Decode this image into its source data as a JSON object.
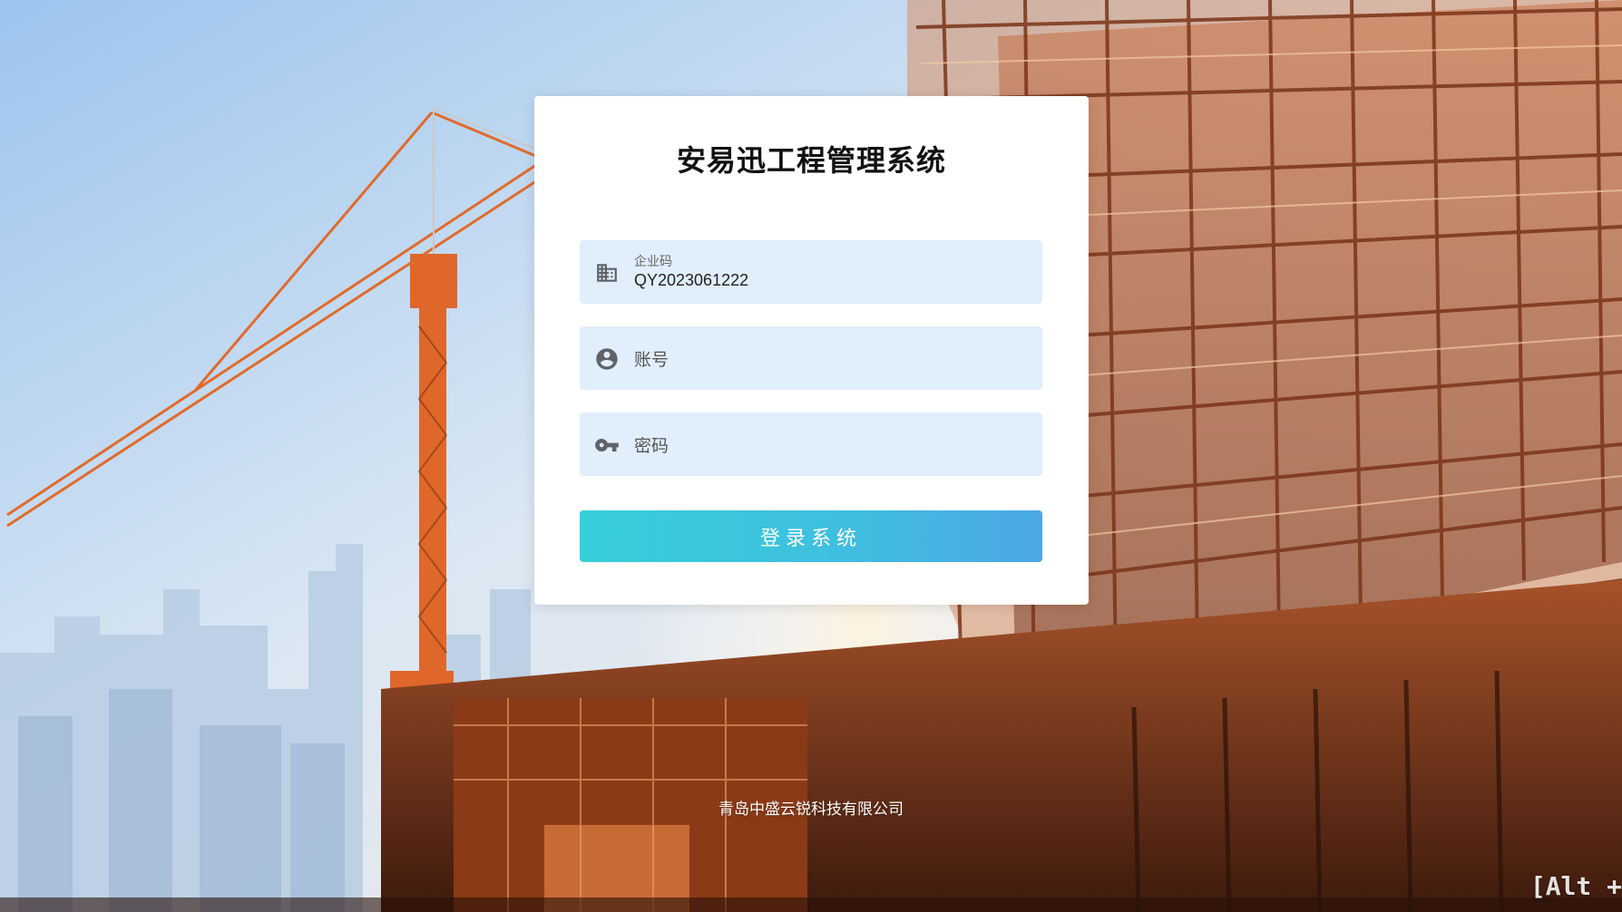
{
  "app": {
    "title": "安易迅工程管理系统"
  },
  "form": {
    "company_code": {
      "label": "企业码",
      "value": "QY2023061222",
      "icon": "building-icon"
    },
    "account": {
      "placeholder": "账号",
      "icon": "account-circle-icon"
    },
    "password": {
      "placeholder": "密码",
      "icon": "key-icon"
    },
    "login_label": "登录系统"
  },
  "footer": {
    "company": "青岛中盛云锐科技有限公司"
  },
  "overlay": {
    "hint": "[Alt +"
  },
  "colors": {
    "field_bg": "#e1eefb",
    "button_gradient_start": "#36cfd9",
    "button_gradient_end": "#4aa8e3",
    "icon": "#5f6368"
  }
}
